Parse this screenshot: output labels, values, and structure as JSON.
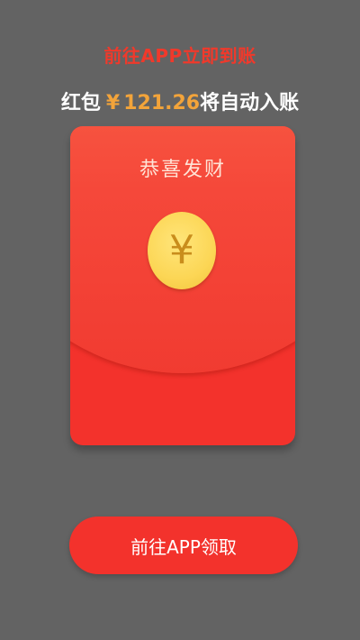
{
  "headline": "前往APP立即到账",
  "amount_line": {
    "prefix": "红包",
    "currency": "¥",
    "amount": "121.26",
    "suffix": "将自动入账"
  },
  "envelope": {
    "title": "恭喜发财",
    "coin_symbol": "¥",
    "coin_icon": "yen-coin-icon"
  },
  "claim_button": {
    "label": "前往APP领取"
  },
  "colors": {
    "background": "#636363",
    "accent_red": "#f3322c",
    "amount_gold": "#f3a43a",
    "coin_gold": "#fcd655"
  }
}
